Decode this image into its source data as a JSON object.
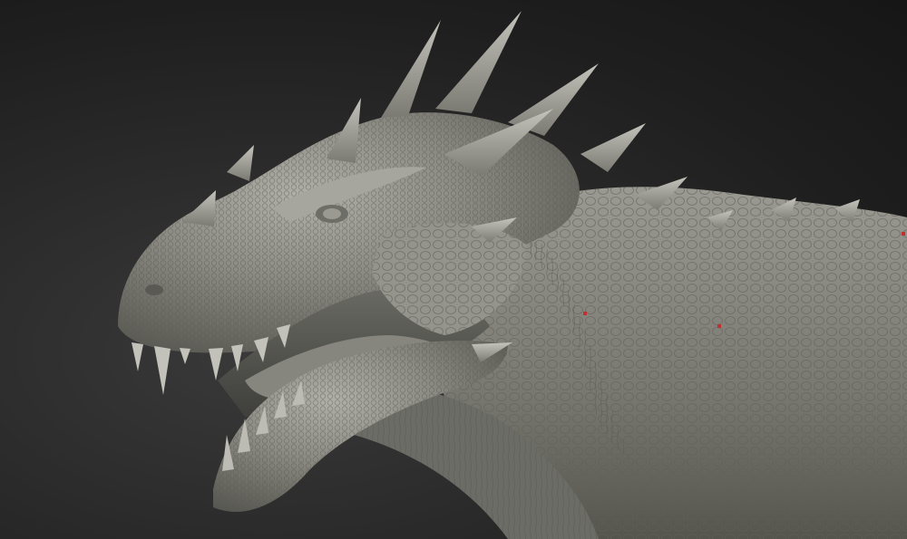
{
  "scene": {
    "subject": "sculpted-dinosaur-head",
    "background_colors": [
      "#3a3a3a",
      "#161616"
    ],
    "model_color": "#8a8a82",
    "model_highlight": "#b8b8b0",
    "model_shadow": "#4a4a44",
    "marker_color": "#c03030"
  }
}
